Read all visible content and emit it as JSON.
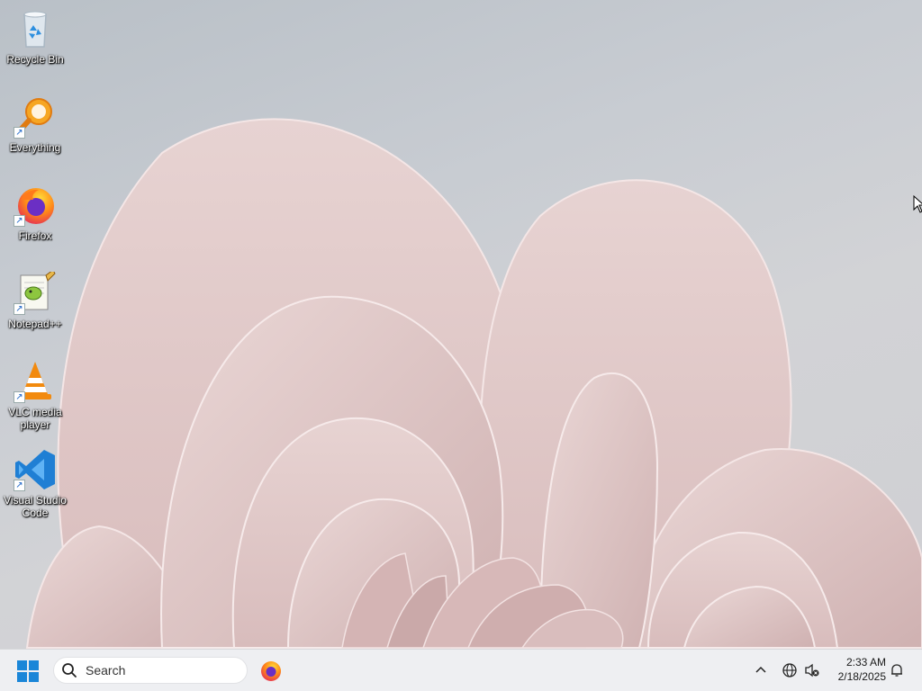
{
  "desktop": {
    "icons": [
      {
        "label": "Recycle Bin",
        "icon": "recycle-bin-icon"
      },
      {
        "label": "Everything",
        "icon": "everything-search-icon"
      },
      {
        "label": "Firefox",
        "icon": "firefox-icon"
      },
      {
        "label": "Notepad++",
        "icon": "notepad-plus-plus-icon"
      },
      {
        "label": "VLC media player",
        "icon": "vlc-icon"
      },
      {
        "label": "Visual Studio Code",
        "icon": "vscode-icon"
      }
    ]
  },
  "taskbar": {
    "search_placeholder": "Search",
    "pinned": [
      {
        "icon": "firefox-icon"
      }
    ],
    "clock": {
      "time": "2:33 AM",
      "date": "2/18/2025"
    }
  },
  "colors": {
    "taskbar_bg": "#eeeff2",
    "windows_blue": "#1a86d8",
    "petal": "#e2c9c8"
  }
}
